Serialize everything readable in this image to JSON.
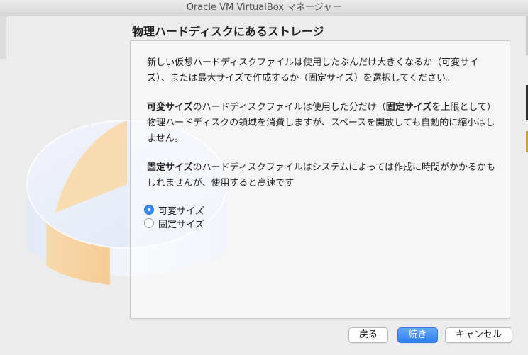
{
  "window": {
    "title": "Oracle VM VirtualBox マネージャー"
  },
  "dialog": {
    "title": "物理ハードディスクにあるストレージ",
    "intro": "新しい仮想ハードディスクファイルは使用したぶんだけ大きくなるか（可変サイズ）、または最大サイズで作成するか（固定サイズ）を選択してください。",
    "dynamic_term": "可変サイズ",
    "dynamic_text_1": "のハードディスクファイルは使用した分だけ（",
    "fixed_term_inline": "固定サイズ",
    "dynamic_text_2": "を上限として）物理ハードディスクの領域を消費しますが、スペースを開放しても自動的に縮小はしません。",
    "fixed_term": "固定サイズ",
    "fixed_text": "のハードディスクファイルはシステムによっては作成に時間がかかるかもしれませんが、使用すると高速です",
    "options": [
      {
        "label": "可変サイズ",
        "selected": true
      },
      {
        "label": "固定サイズ",
        "selected": false
      }
    ]
  },
  "buttons": {
    "back": "戻る",
    "next": "続き",
    "cancel": "キャンセル"
  },
  "colors": {
    "accent": "#3a8df5",
    "disk_orange": "#f6c98a",
    "disk_blue": "#d6e0f5"
  }
}
